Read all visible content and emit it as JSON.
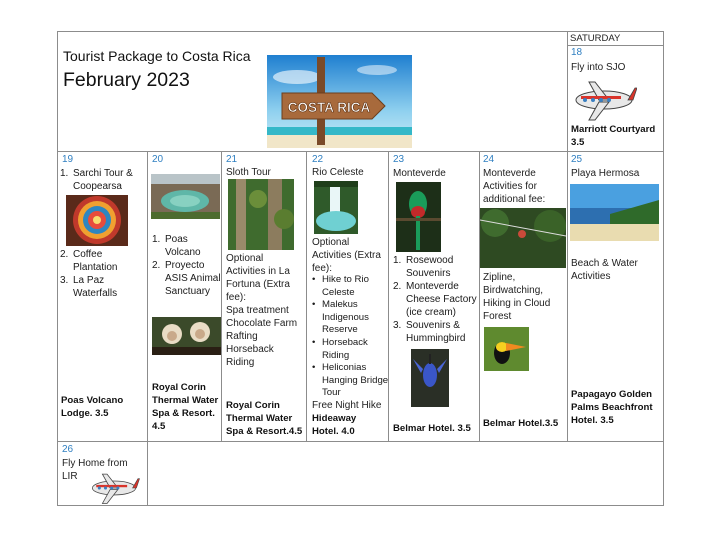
{
  "header": {
    "saturday_label": "SATURDAY",
    "title": "Tourist Package to Costa Rica",
    "month": "February 2023",
    "banner_sign": "COSTA RICA"
  },
  "days": {
    "d18": {
      "num": "18",
      "text": "Fly into SJO",
      "hotel": "Marriott Courtyard 3.5"
    },
    "d19": {
      "num": "19",
      "items": [
        "Sarchi Tour & Coopearsa",
        "Coffee Plantation",
        "La Paz Waterfalls"
      ],
      "nums": [
        "1.",
        "2.",
        "3."
      ],
      "hotel": "Poas Volcano Lodge. 3.5"
    },
    "d20": {
      "num": "20",
      "items": [
        "Poas Volcano",
        "Proyecto ASIS Animal Sanctuary"
      ],
      "nums": [
        "1.",
        "2."
      ],
      "hotel": "Royal Corin Thermal Water Spa & Resort. 4.5"
    },
    "d21": {
      "num": "21",
      "title": "Sloth Tour",
      "optional": "Optional Activities in La Fortuna (Extra fee):",
      "extras": [
        "Spa treatment",
        "Chocolate Farm",
        "Rafting",
        "Horseback Riding"
      ],
      "hotel": "Royal Corin Thermal Water Spa & Resort.4.5"
    },
    "d22": {
      "num": "22",
      "title": "Rio Celeste",
      "optional": "Optional Activities (Extra fee):",
      "bullets": [
        "Hike to Rio Celeste",
        "Malekus Indigenous Reserve",
        "Horseback Riding",
        "Heliconias Hanging Bridge Tour"
      ],
      "extra": "Free Night Hike",
      "hotel": "Hideaway Hotel. 4.0"
    },
    "d23": {
      "num": "23",
      "title": "Monteverde",
      "items": [
        "Rosewood Souvenirs",
        "Monteverde Cheese Factory (ice cream)",
        "Souvenirs & Hummingbird"
      ],
      "nums": [
        "1.",
        "2.",
        "3."
      ],
      "hotel": "Belmar Hotel. 3.5"
    },
    "d24": {
      "num": "24",
      "title": "Monteverde Activities for additional fee:",
      "activities": "Zipline, Birdwatching, Hiking in Cloud Forest",
      "hotel": "Belmar Hotel.3.5"
    },
    "d25": {
      "num": "25",
      "title": "Playa Hermosa",
      "activities": "Beach & Water Activities",
      "hotel": "Papagayo Golden Palms Beachfront Hotel. 3.5"
    },
    "d26": {
      "num": "26",
      "text": "Fly Home from LIR"
    }
  },
  "icons": {
    "airplane": "airplane-icon",
    "colors": {
      "day_number": "#2f7fc1",
      "grid": "#8c8c8c",
      "plane_body": "#e8e8e8",
      "plane_accent": "#d9342b"
    }
  }
}
